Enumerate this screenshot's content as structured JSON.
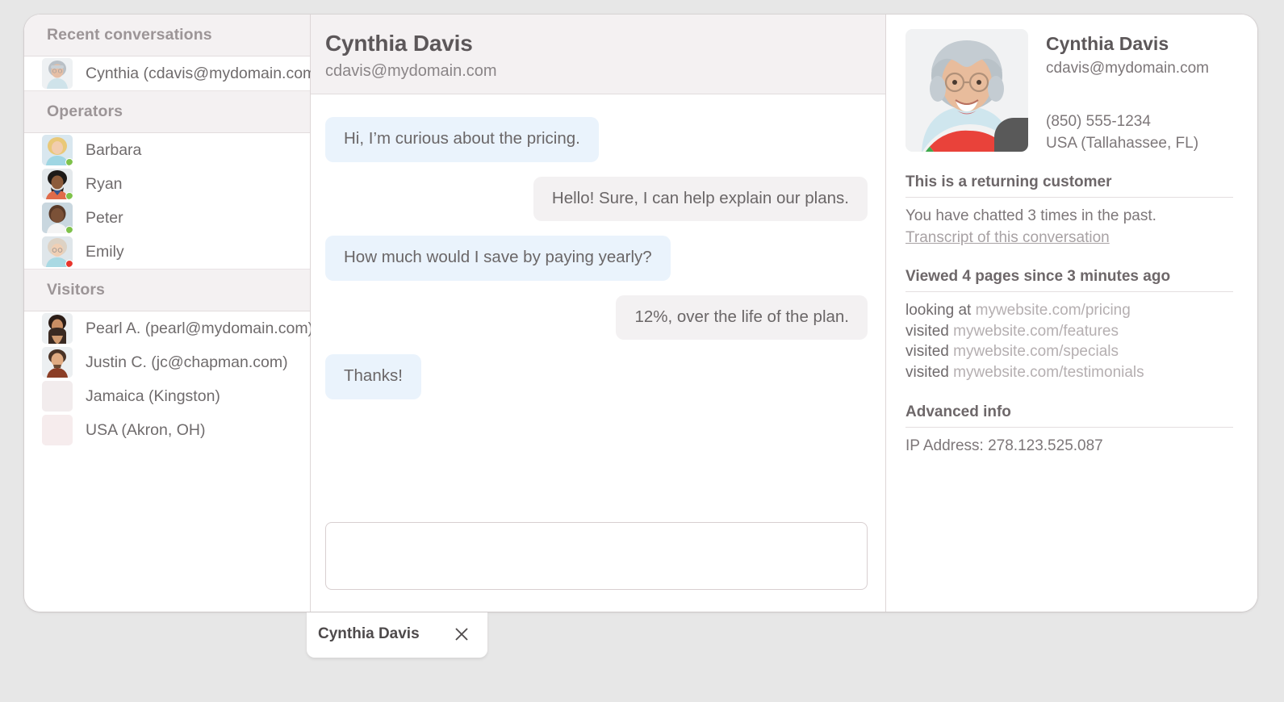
{
  "sidebar": {
    "sections": [
      {
        "title": "Recent conversations"
      },
      {
        "title": "Operators"
      },
      {
        "title": "Visitors"
      }
    ],
    "recent": [
      {
        "label": "Cynthia (cdavis@mydomain.com)",
        "avatar": "cynthia",
        "status": "none"
      }
    ],
    "operators": [
      {
        "label": "Barbara",
        "avatar": "barbara",
        "status": "online"
      },
      {
        "label": "Ryan",
        "avatar": "ryan",
        "status": "online"
      },
      {
        "label": "Peter",
        "avatar": "peter",
        "status": "online"
      },
      {
        "label": "Emily",
        "avatar": "emily",
        "status": "offline"
      }
    ],
    "visitors": [
      {
        "label": "Pearl A. (pearl@mydomain.com)",
        "avatar": "pearl",
        "status": "none"
      },
      {
        "label": "Justin C. (jc@chapman.com)",
        "avatar": "justin",
        "status": "none"
      },
      {
        "label": "Jamaica (Kingston)",
        "avatar": "blank",
        "status": "none"
      },
      {
        "label": "USA (Akron, OH)",
        "avatar": "blank",
        "status": "none"
      }
    ]
  },
  "chat": {
    "header": {
      "name": "Cynthia Davis",
      "email": "cdavis@mydomain.com"
    },
    "messages": [
      {
        "dir": "in",
        "text": "Hi, I’m curious about the pricing."
      },
      {
        "dir": "out",
        "text": "Hello! Sure, I can help explain our plans."
      },
      {
        "dir": "in",
        "text": "How much would I save by paying yearly?"
      },
      {
        "dir": "out",
        "text": "12%, over the life of the plan."
      },
      {
        "dir": "in",
        "text": "Thanks!"
      }
    ],
    "composer": {
      "value": "",
      "placeholder": ""
    }
  },
  "details": {
    "profile": {
      "name": "Cynthia Davis",
      "email": "cdavis@mydomain.com",
      "phone": "(850) 555-1234",
      "location": "USA (Tallahassee, FL)",
      "browser_icon": "chrome-icon",
      "os_icon": "apple-icon"
    },
    "returning": {
      "title": "This is a returning customer",
      "text": "You have chatted 3 times in the past.",
      "link": "Transcript of this conversation"
    },
    "pages": {
      "title": "Viewed 4 pages since 3 minutes ago",
      "items": [
        {
          "verb": "looking at",
          "url": "mywebsite.com/pricing"
        },
        {
          "verb": "visited",
          "url": "mywebsite.com/features"
        },
        {
          "verb": "visited",
          "url": "mywebsite.com/specials"
        },
        {
          "verb": "visited",
          "url": "mywebsite.com/testimonials"
        }
      ]
    },
    "advanced": {
      "title": "Advanced info",
      "ip": "IP Address: 278.123.525.087"
    }
  },
  "tabbar": {
    "tabs": [
      {
        "label": "Cynthia Davis",
        "close_icon": "close-icon"
      }
    ]
  },
  "colors": {
    "bubble_in": "#eaf3fc",
    "bubble_out": "#f3f1f2",
    "section_header_bg": "#f4f1f2",
    "status_online": "#7ec24a",
    "status_offline": "#e8352c",
    "page_bg": "#e7e7e7"
  }
}
